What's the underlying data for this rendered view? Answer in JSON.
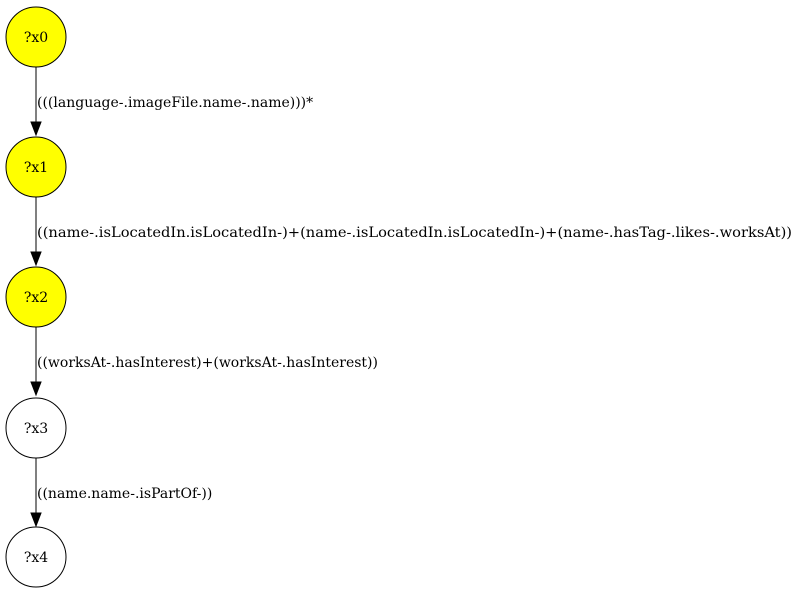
{
  "graph": {
    "nodes": [
      {
        "id": "x0",
        "label": "?x0",
        "fill": "#ffff00"
      },
      {
        "id": "x1",
        "label": "?x1",
        "fill": "#ffff00"
      },
      {
        "id": "x2",
        "label": "?x2",
        "fill": "#ffff00"
      },
      {
        "id": "x3",
        "label": "?x3",
        "fill": "#ffffff"
      },
      {
        "id": "x4",
        "label": "?x4",
        "fill": "#ffffff"
      }
    ],
    "edges": [
      {
        "from": "x0",
        "to": "x1",
        "label": "(((language-.imageFile.name-.name)))*"
      },
      {
        "from": "x1",
        "to": "x2",
        "label": "((name-.isLocatedIn.isLocatedIn-)+(name-.isLocatedIn.isLocatedIn-)+(name-.hasTag-.likes-.worksAt))"
      },
      {
        "from": "x2",
        "to": "x3",
        "label": "((worksAt-.hasInterest)+(worksAt-.hasInterest))"
      },
      {
        "from": "x3",
        "to": "x4",
        "label": "((name.name-.isPartOf-))"
      }
    ]
  }
}
